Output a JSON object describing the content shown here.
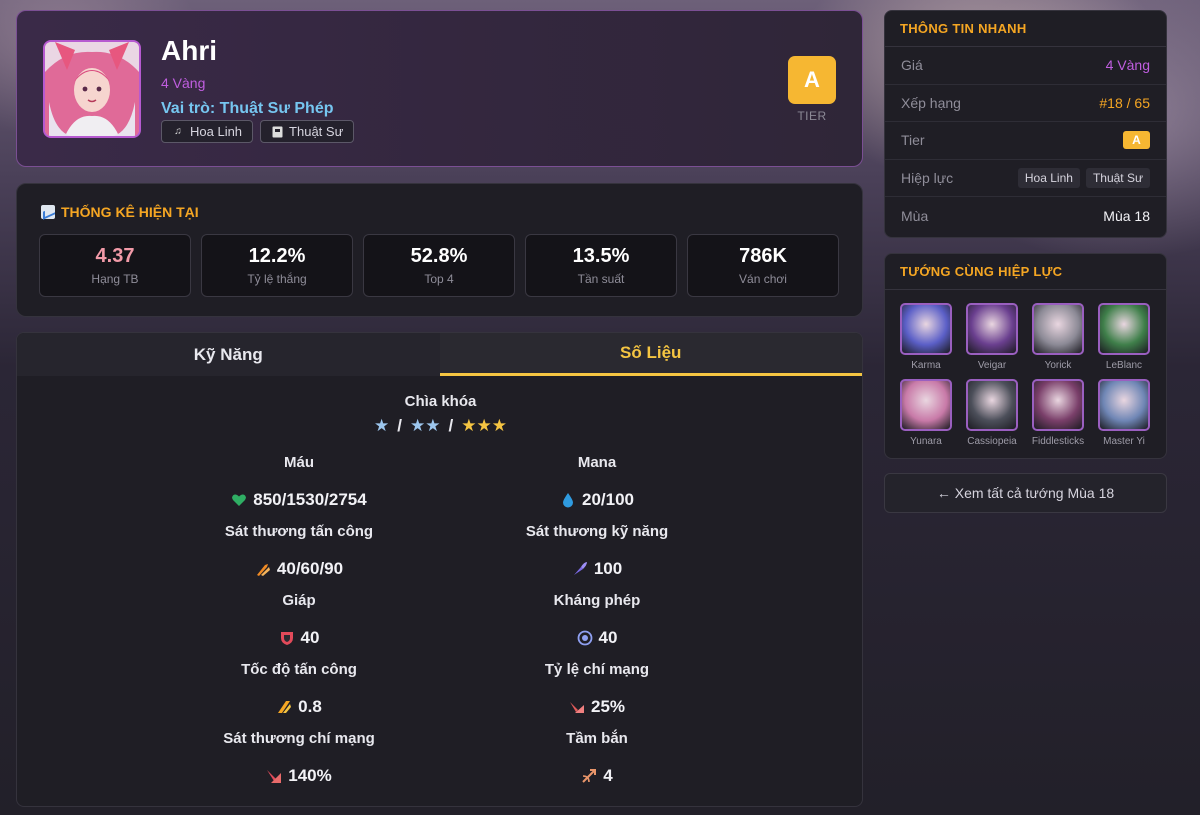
{
  "champion": {
    "name": "Ahri",
    "cost": "4 Vàng",
    "role": "Vai trò: Thuật Sư Phép",
    "traits": [
      {
        "label": "Hoa Linh",
        "icon": "music-note-icon"
      },
      {
        "label": "Thuật Sư",
        "icon": "book-icon"
      }
    ],
    "tier": "A",
    "tier_label": "TIER"
  },
  "stats": {
    "title": "THỐNG KÊ HIỆN TẠI",
    "items": [
      {
        "value": "4.37",
        "label": "Hạng TB"
      },
      {
        "value": "12.2%",
        "label": "Tỷ lệ thắng"
      },
      {
        "value": "52.8%",
        "label": "Top 4"
      },
      {
        "value": "13.5%",
        "label": "Tần suất"
      },
      {
        "value": "786K",
        "label": "Ván chơi"
      }
    ]
  },
  "tabs": [
    {
      "label": "Kỹ Năng",
      "active": false
    },
    {
      "label": "Số Liệu",
      "active": true
    }
  ],
  "numbers": {
    "key_label": "Chìa khóa",
    "star_levels": [
      "★",
      "★★",
      "★★★"
    ],
    "separator": "/",
    "rows": [
      {
        "left": {
          "label": "Máu",
          "value": "850/1530/2754",
          "icon": "heart-icon"
        },
        "right": {
          "label": "Mana",
          "value": "20/100",
          "icon": "droplet-icon"
        }
      },
      {
        "left": {
          "label": "Sát thương tấn công",
          "value": "40/60/90",
          "icon": "sword-icon"
        },
        "right": {
          "label": "Sát thương kỹ năng",
          "value": "100",
          "icon": "magic-icon"
        }
      },
      {
        "left": {
          "label": "Giáp",
          "value": "40",
          "icon": "shield-icon"
        },
        "right": {
          "label": "Kháng phép",
          "value": "40",
          "icon": "magic-resist-icon"
        }
      },
      {
        "left": {
          "label": "Tốc độ tấn công",
          "value": "0.8",
          "icon": "attack-speed-icon"
        },
        "right": {
          "label": "Tỷ lệ chí mạng",
          "value": "25%",
          "icon": "crit-chance-icon"
        }
      },
      {
        "left": {
          "label": "Sát thương chí mạng",
          "value": "140%",
          "icon": "crit-damage-icon"
        },
        "right": {
          "label": "Tầm bắn",
          "value": "4",
          "icon": "range-icon"
        }
      }
    ]
  },
  "quick_info": {
    "title": "THÔNG TIN NHANH",
    "price_label": "Giá",
    "price_value": "4 Vàng",
    "rank_label": "Xếp hạng",
    "rank_value": "#18 / 65",
    "tier_label": "Tier",
    "tier_value": "A",
    "synergy_label": "Hiệp lực",
    "synergies": [
      "Hoa Linh",
      "Thuật Sư"
    ],
    "season_label": "Mùa",
    "season_value": "Mùa 18"
  },
  "same_synergy": {
    "title": "TƯỚNG CÙNG HIỆP LỰC",
    "champions": [
      {
        "name": "Karma",
        "color": "#5b5fc7"
      },
      {
        "name": "Veigar",
        "color": "#6a3f8f"
      },
      {
        "name": "Yorick",
        "color": "#8c8a96"
      },
      {
        "name": "LeBlanc",
        "color": "#3f7f4a"
      },
      {
        "name": "Yunara",
        "color": "#c87aa8"
      },
      {
        "name": "Cassiopeia",
        "color": "#4c4f5a"
      },
      {
        "name": "Fiddlesticks",
        "color": "#7a3f6a"
      },
      {
        "name": "Master Yi",
        "color": "#6f86b5"
      }
    ]
  },
  "view_all": "← Xem tất cả tướng Mùa 18",
  "colors": {
    "accent": "#f5a623",
    "tab_active": "#f5c542",
    "tier": "#f6b732",
    "cost": "#c05ee0"
  }
}
